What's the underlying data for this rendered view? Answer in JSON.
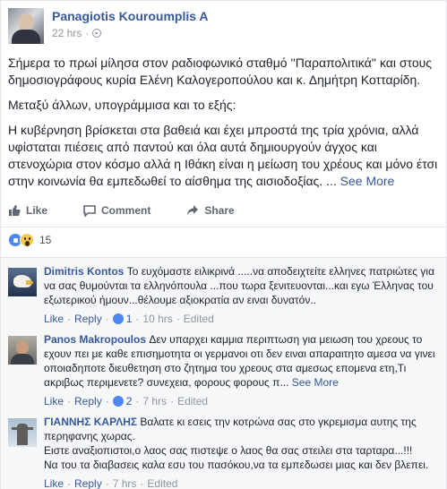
{
  "post": {
    "author": "Panagiotis Kouroumplis A",
    "time": "22 hrs",
    "dot": "·",
    "paragraphs": [
      "Σήμερα το πρωί μίλησα στον ραδιοφωνικό σταθμό ''Παραπολιτικά'' και στους δημοσιογράφους κυρία Ελένη Καλογεροπούλου και κ. Δημήτρη Κοτταρίδη.",
      "Μεταξύ άλλων, υπογράμμισα και το εξής:",
      "Η κυβέρνηση βρίσκεται στα βαθειά και έχει μπροστά της τρία χρόνια, αλλά υφίσταται πιέσεις από παντού και όλα αυτά δημιουργούν άγχος και στενοχώρια στον κόσμο αλλά η Ιθάκη είναι η μείωση του χρέους και μόνο έτσι στην κοινωνία θα εμπεδωθεί το αίσθημα της αισιοδοξίας. ..."
    ],
    "see_more": "See More"
  },
  "actions": {
    "like": "Like",
    "comment": "Comment",
    "share": "Share"
  },
  "reactions": {
    "count": "15"
  },
  "comments": [
    {
      "name": "Dimitris Kontos",
      "text": "Το ευχόμαστε ειλικρινά .....να αποδειχτείτε ελληνες πατριώτες για να σας θυμούνται τα ελληνόπουλα ...που τωρα ξενιτευονται...και εγω Έλληνας του εξωτερικού ήμουν...θέλουμε αξιοκρατία αν ειναι δυνατόν..",
      "like": "Like",
      "reply": "Reply",
      "likes": "1",
      "time": "10 hrs",
      "edited": "Edited",
      "see_more": ""
    },
    {
      "name": "Panos Makropoulos",
      "text": "Δεν υπαρχει καμμια περιπτωση για μειωση του χρεους το εχουν πει με καθε επισημοτητα οι γερμανοι οτι δεν ειναι απαραιτητο αμεσα να γινει οποιαδηποτε διευθετηση στο ζητημα του χρεους στα αμεσως επομενα ετη,Τι ακριβως περιμενετε? συνεχεια, φορους φορους π...",
      "like": "Like",
      "reply": "Reply",
      "likes": "2",
      "time": "7 hrs",
      "edited": "Edited",
      "see_more": "See More"
    },
    {
      "name": "ΓΙΑΝΝΗΣ ΚΑΡΛΗΣ",
      "text": "Βαλατε κι εσεις την κοτρώνα σας στο γκρεμισμα αυτης της περηφανης χωρας.",
      "text2": "Ειστε αναξιοπιστοι,ο λαος σας πιστεψε ο λαος θα σας στειλει στα ταρταρα...!!!",
      "text3": "Να του τα διαβασεις καλα εσυ του πασόκου,να τα εμπεδωσει μιας και δεν βλεπει.",
      "like": "Like",
      "reply": "Reply",
      "time": "7 hrs",
      "edited": "Edited"
    }
  ],
  "colors": {
    "link": "#365899",
    "meta": "#90949c",
    "text": "#1d2129",
    "like_blue": "#4e86f5"
  }
}
